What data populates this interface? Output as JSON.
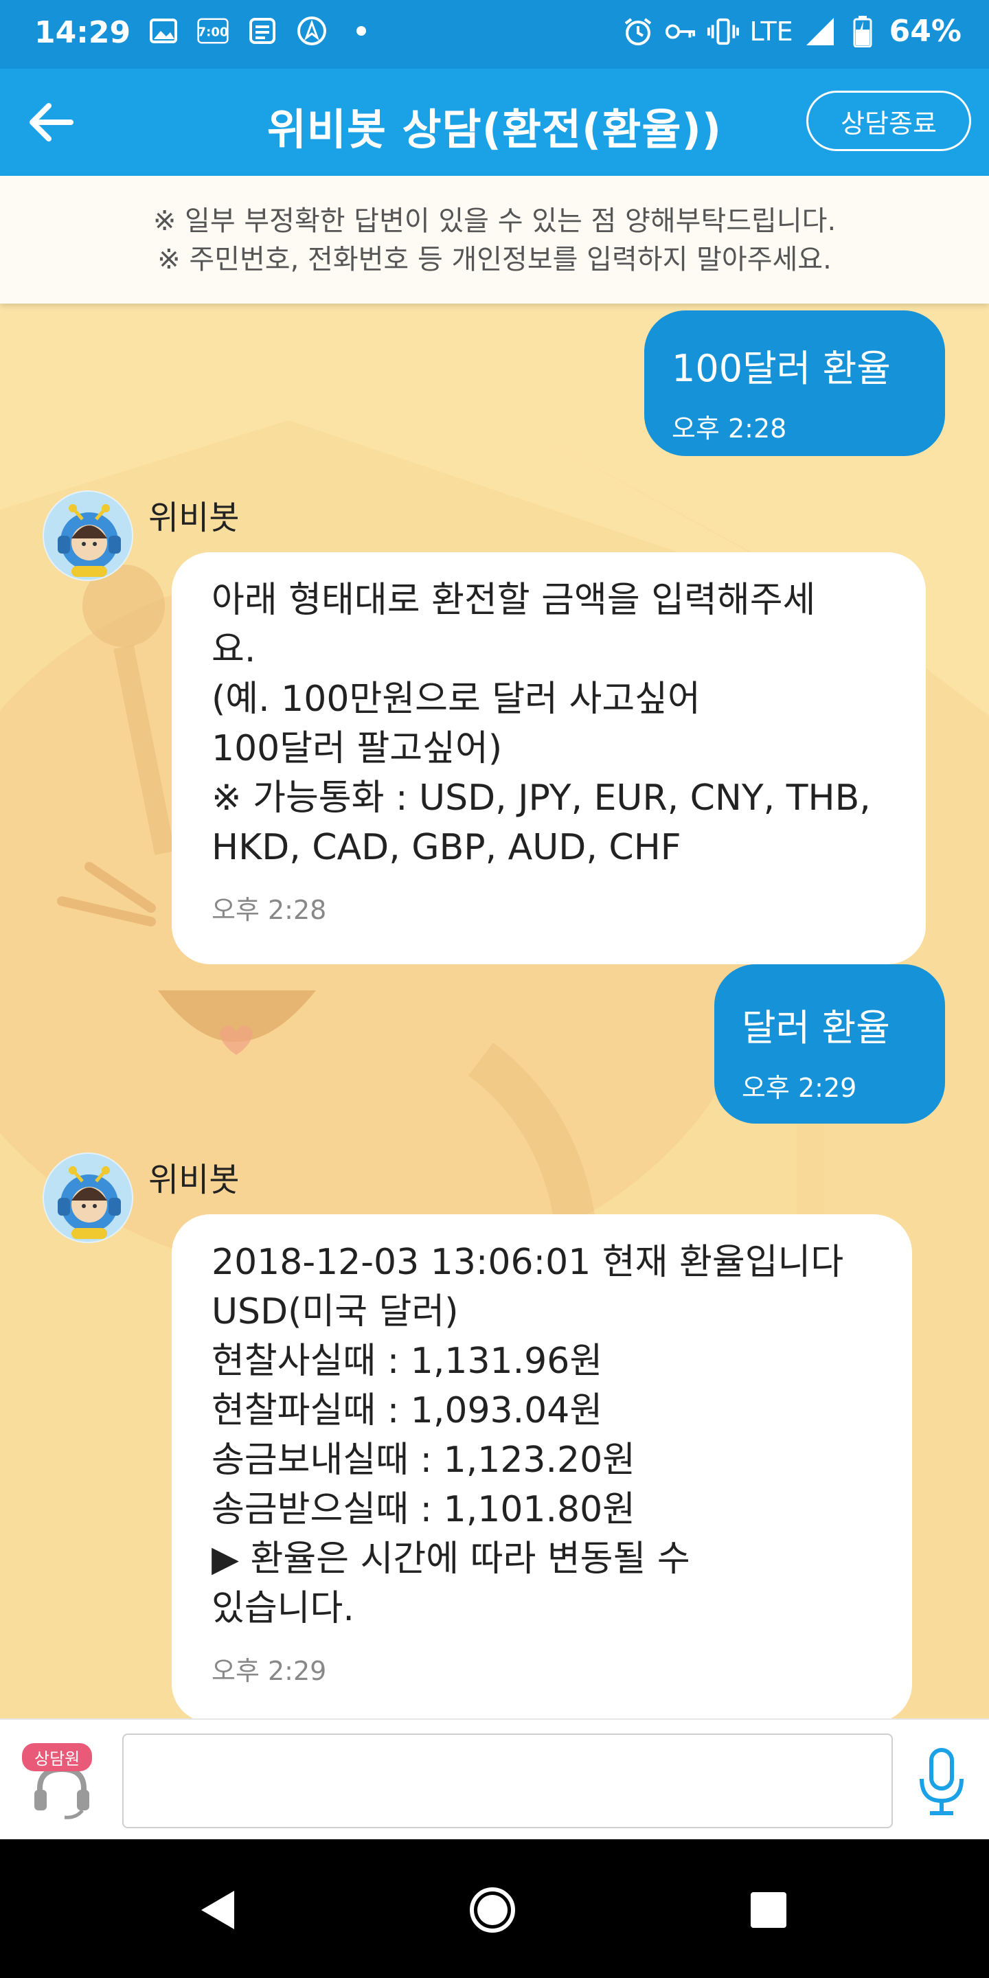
{
  "status_bar": {
    "time": "14:29",
    "network": "LTE",
    "battery": "64%",
    "icons": [
      "image-icon",
      "kakao-notification-icon",
      "news-icon",
      "navigation-icon",
      "dot-icon",
      "alarm-icon",
      "key-icon",
      "vibrate-icon",
      "signal-icon",
      "battery-icon"
    ]
  },
  "header": {
    "back_icon": "arrow-left-icon",
    "title": "위비봇 상담(환전(환율))",
    "end_button": "상담종료"
  },
  "notice": {
    "line1": "※ 일부 부정확한 답변이 있을 수 있는 점 양해부탁드립니다.",
    "line2": "※ 주민번호, 전화번호 등 개인정보를 입력하지 말아주세요."
  },
  "messages": [
    {
      "sender": "user",
      "text": "100달러 환율",
      "time": "오후 2:28"
    },
    {
      "sender": "bot",
      "name": "위비봇",
      "text": "아래 형태대로 환전할 금액을 입력해주세\n요.\n(예. 100만원으로 달러 사고싶어\n100달러 팔고싶어)\n※ 가능통화 : USD, JPY, EUR, CNY, THB,\nHKD, CAD, GBP, AUD, CHF",
      "time": "오후 2:28"
    },
    {
      "sender": "user",
      "text": "달러 환율",
      "time": "오후 2:29"
    },
    {
      "sender": "bot",
      "name": "위비봇",
      "text": "2018-12-03 13:06:01 현재 환율입니다\nUSD(미국 달러)\n현찰사실때 : 1,131.96원\n현찰파실때 : 1,093.04원\n송금보내실때 : 1,123.20원\n송금받으실때 : 1,101.80원\n▶ 환율은 시간에 따라 변동될 수\n있습니다.",
      "time": "오후 2:29"
    }
  ],
  "input_bar": {
    "agent_badge": "상담원",
    "agent_icon": "headset-icon",
    "input_value": "",
    "mic_icon": "microphone-icon"
  },
  "nav_bar": {
    "icons": [
      "back-triangle-icon",
      "home-circle-icon",
      "recents-square-icon"
    ]
  },
  "colors": {
    "header_blue": "#1aa1e6",
    "status_blue": "#1592d8",
    "user_bubble": "#1592d8",
    "background": "#fbe3a6"
  }
}
